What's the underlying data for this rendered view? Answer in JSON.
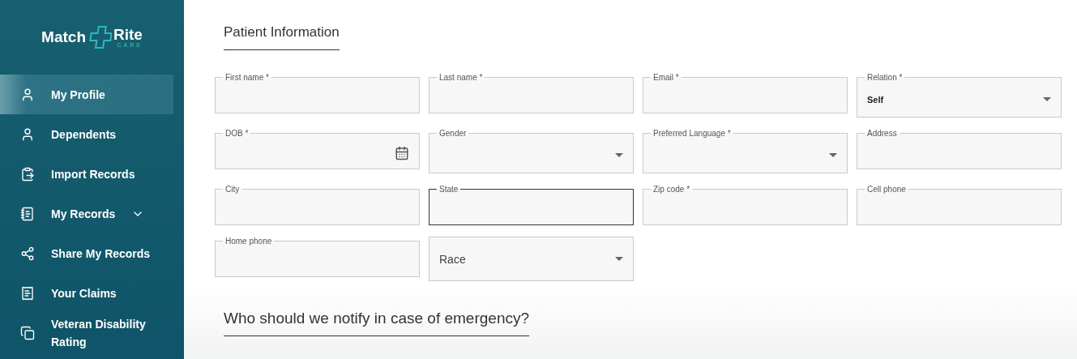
{
  "logo": {
    "word_left": "Match",
    "word_right": "Rite",
    "tagline": "CARE"
  },
  "sidebar": {
    "items": [
      {
        "label": "My Profile",
        "selected": true
      },
      {
        "label": "Dependents",
        "selected": false
      },
      {
        "label": "Import Records",
        "selected": false
      },
      {
        "label": "My Records",
        "selected": false,
        "expandable": true
      },
      {
        "label": "Share My Records",
        "selected": false
      },
      {
        "label": "Your Claims",
        "selected": false
      },
      {
        "label": "Veteran Disability Rating",
        "selected": false
      }
    ]
  },
  "patient_section": {
    "title": "Patient Information",
    "fields": [
      {
        "kind": "text",
        "label": "First name *"
      },
      {
        "kind": "text",
        "label": "Last name *"
      },
      {
        "kind": "text",
        "label": "Email *"
      },
      {
        "kind": "select",
        "label": "Relation *",
        "value": "Self"
      },
      {
        "kind": "date",
        "label": "DOB *"
      },
      {
        "kind": "select",
        "label": "Gender"
      },
      {
        "kind": "select",
        "label": "Preferred Language *"
      },
      {
        "kind": "text",
        "label": "Address"
      },
      {
        "kind": "text",
        "label": "City"
      },
      {
        "kind": "text",
        "label": "State",
        "focused": true
      },
      {
        "kind": "text",
        "label": "Zip code *"
      },
      {
        "kind": "text",
        "label": "Cell phone"
      },
      {
        "kind": "text",
        "label": "Home phone"
      },
      {
        "kind": "select",
        "placeholder": "Race"
      }
    ]
  },
  "emergency_section": {
    "title": "Who should we notify in case of emergency?"
  }
}
